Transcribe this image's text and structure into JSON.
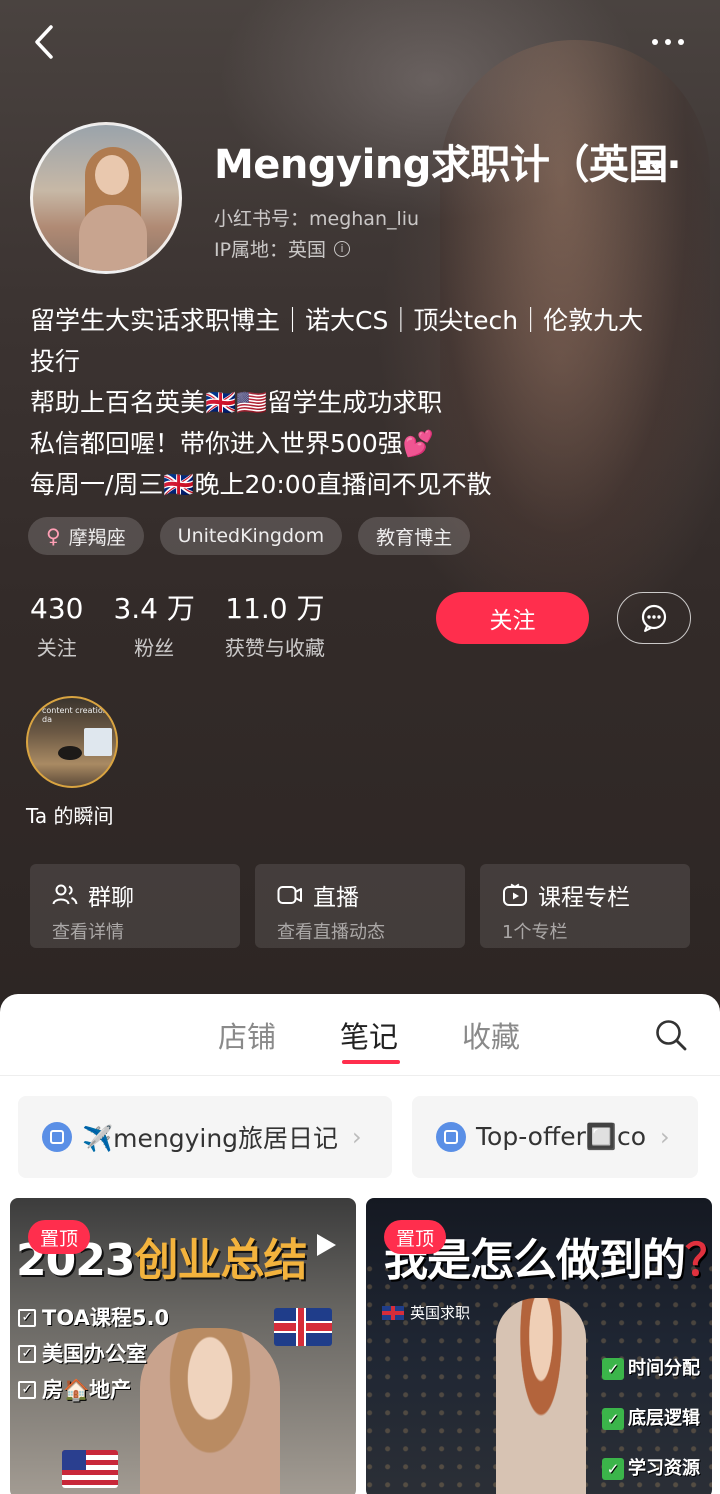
{
  "profile": {
    "username": "Mengying求职计（英国",
    "username_overflow": "...",
    "red_id": "小红书号：meghan_liu",
    "ip_location": "IP属地：英国",
    "bio_lines": [
      "留学生大实话求职博主｜诺大CS｜顶尖tech｜伦敦九大",
      "投行",
      "帮助上百名英美🇬🇧🇺🇸留学生成功求职",
      "私信都回喔！带你进入世界500强💕",
      "每周一/周三🇬🇧晚上20:00直播间不见不散"
    ],
    "tags": {
      "zodiac": "摩羯座",
      "location": "UnitedKingdom",
      "category": "教育博主"
    },
    "stats": {
      "following": {
        "value": "430",
        "label": "关注"
      },
      "followers": {
        "value": "3.4 万",
        "label": "粉丝"
      },
      "likes": {
        "value": "11.0 万",
        "label": "获赞与收藏"
      }
    },
    "follow_label": "关注",
    "moment": {
      "label": "Ta 的瞬间",
      "thumb_caption": "content creation da"
    }
  },
  "features": [
    {
      "icon": "group-icon",
      "title": "群聊",
      "subtitle": "查看详情"
    },
    {
      "icon": "video-camera-icon",
      "title": "直播",
      "subtitle": "查看直播动态"
    },
    {
      "icon": "course-play-icon",
      "title": "课程专栏",
      "subtitle": "1个专栏"
    }
  ],
  "tabs": {
    "shop": "店铺",
    "notes": "笔记",
    "collect": "收藏",
    "active": "notes"
  },
  "collections": [
    {
      "label": "✈️mengying旅居日记"
    },
    {
      "label": "Top-offer🔲co"
    }
  ],
  "notes": [
    {
      "pin": "置顶",
      "title_prefix": "2023",
      "title_highlight": "创业总结",
      "checklist": [
        "TOA课程5.0",
        "美国办公室",
        "房🏠地产"
      ]
    },
    {
      "pin": "置顶",
      "title": "我是怎么做到的",
      "title_mark": "？",
      "region": "英国求职",
      "points": [
        "时间分配",
        "底层逻辑",
        "学习资源"
      ]
    }
  ],
  "colors": {
    "accent": "#ff2e4d",
    "background": "#2b2523",
    "sheet": "#ffffff"
  }
}
